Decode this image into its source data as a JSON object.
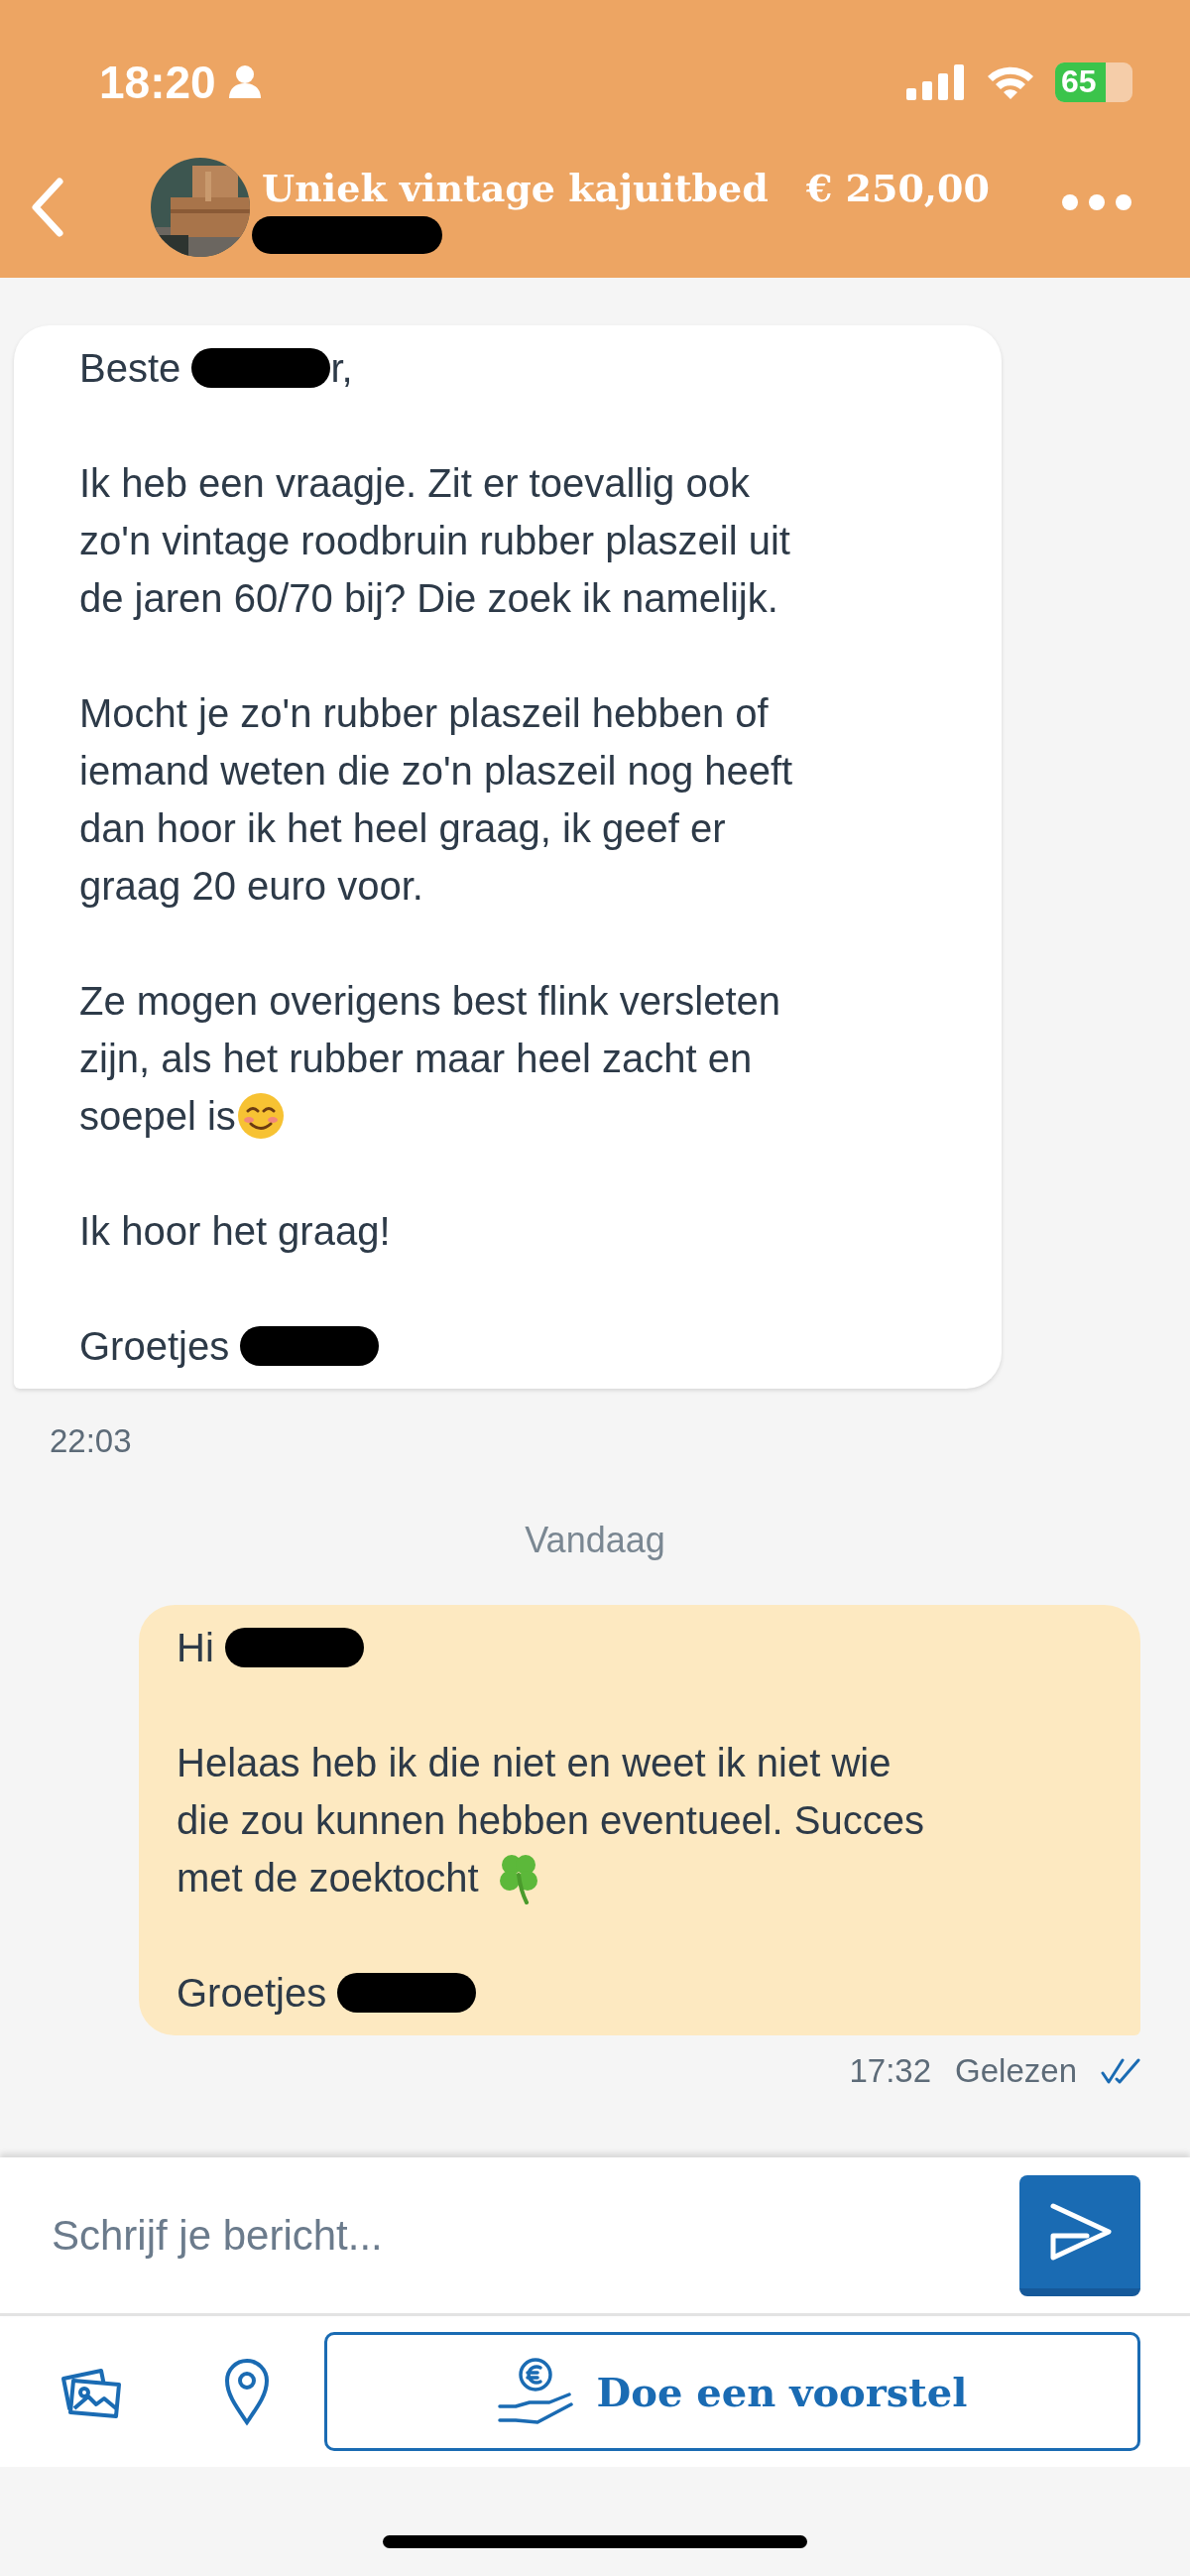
{
  "status_bar": {
    "time": "18:20",
    "battery": "65"
  },
  "header": {
    "title": "Uniek vintage kajuitbed",
    "price": "€ 250,00"
  },
  "thread": [
    {
      "kind": "message",
      "outgoing": false,
      "time": "22:03",
      "paragraphs": [
        [
          [
            {
              "kind": "text",
              "text": "Beste "
            },
            {
              "kind": "redaction"
            },
            {
              "kind": "text",
              "text": "r,"
            }
          ]
        ],
        [
          [
            {
              "kind": "text",
              "text": "Ik heb een vraagje. Zit er toevallig ook"
            }
          ],
          [
            {
              "kind": "text",
              "text": "zo'n vintage roodbruin rubber plaszeil uit"
            }
          ],
          [
            {
              "kind": "text",
              "text": "de jaren 60/70 bij? Die zoek ik namelijk."
            }
          ]
        ],
        [
          [
            {
              "kind": "text",
              "text": "Mocht je zo'n rubber plaszeil hebben of"
            }
          ],
          [
            {
              "kind": "text",
              "text": "iemand weten die zo'n plaszeil nog heeft"
            }
          ],
          [
            {
              "kind": "text",
              "text": "dan hoor ik het heel graag, ik geef er"
            }
          ],
          [
            {
              "kind": "text",
              "text": "graag 20 euro voor."
            }
          ]
        ],
        [
          [
            {
              "kind": "text",
              "text": "Ze mogen overigens best flink versleten"
            }
          ],
          [
            {
              "kind": "text",
              "text": "zijn, als het rubber maar heel zacht en"
            }
          ],
          [
            {
              "kind": "text",
              "text": "soepel is"
            },
            {
              "kind": "smiley"
            }
          ]
        ],
        [
          [
            {
              "kind": "text",
              "text": "Ik hoor het graag!"
            }
          ]
        ],
        [
          [
            {
              "kind": "text",
              "text": "Groetjes "
            },
            {
              "kind": "redaction"
            }
          ]
        ]
      ]
    },
    {
      "kind": "date",
      "text": "Vandaag"
    },
    {
      "kind": "message",
      "outgoing": true,
      "time": "17:32",
      "status": "Gelezen",
      "read": true,
      "paragraphs": [
        [
          [
            {
              "kind": "text",
              "text": "Hi "
            },
            {
              "kind": "redaction"
            }
          ]
        ],
        [
          [
            {
              "kind": "text",
              "text": "Helaas heb ik die niet en weet ik niet wie"
            }
          ],
          [
            {
              "kind": "text",
              "text": "die zou kunnen hebben eventueel. Succes"
            }
          ],
          [
            {
              "kind": "text",
              "text": "met de zoektocht "
            },
            {
              "kind": "clover"
            }
          ]
        ],
        [
          [
            {
              "kind": "text",
              "text": "Groetjes "
            },
            {
              "kind": "redaction"
            }
          ]
        ]
      ]
    }
  ],
  "composer": {
    "placeholder": "Schrijf je bericht..."
  },
  "offer_button": {
    "label": "Doe een voorstel"
  }
}
